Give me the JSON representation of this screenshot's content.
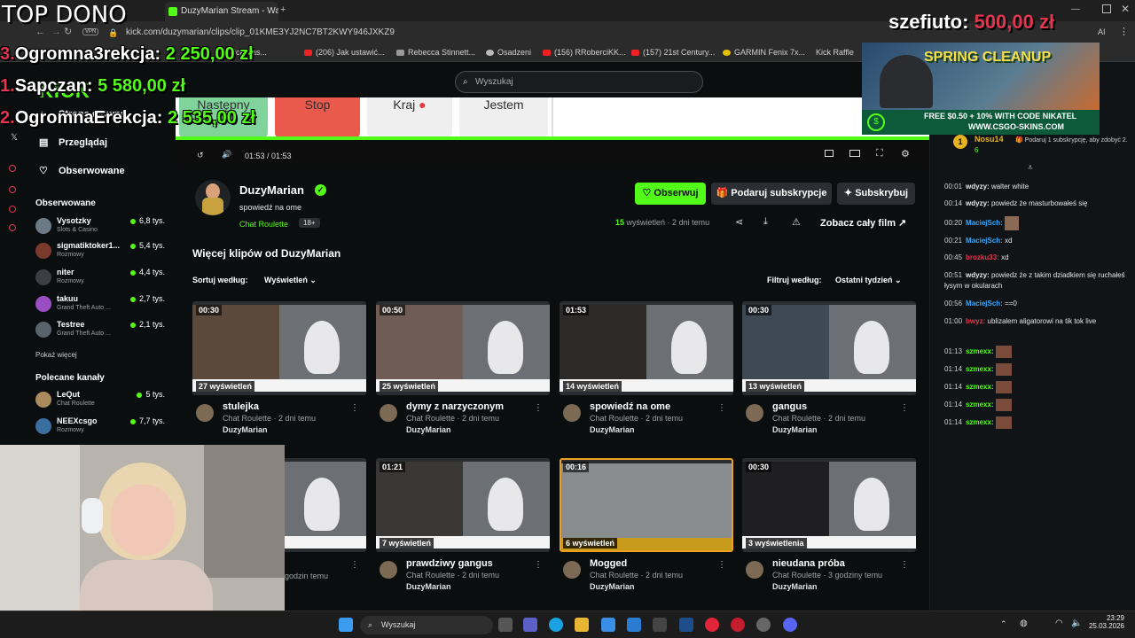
{
  "browser": {
    "tab_title": "DuzyMarian Stream - Watc",
    "url": "kick.com/duzymarian/clips/clip_01KME3YJ2NC7BT2KWY946JXKZ9",
    "vpn_badge": "VPN",
    "bookmarks": [
      "ick Das...",
      "(206) Jak ustawić...",
      "Rebecca Stinnett...",
      "Osadzeni",
      "(156) RRoberciKK...",
      "(157) 21st Century...",
      "GARMIN Fenix 7x...",
      "Kick Raffle"
    ]
  },
  "overlay": {
    "top_label": "TOP DONO",
    "donors": [
      {
        "rank": "3.",
        "name": "Ogromna3rekcja:",
        "amount": "2 250,00 zł"
      },
      {
        "rank": "1.",
        "name": "Sapczan:",
        "amount": "5 580,00 zł"
      },
      {
        "rank": "2.",
        "name": "OgromnaErekcja:",
        "amount": "2 535,00 zł"
      }
    ],
    "top_right": {
      "name": "szefiuto:",
      "amount": "500,00 zł"
    },
    "promo": {
      "title": "SPRING CLEANUP",
      "line1": "FREE $0.50 + 10% WITH CODE NIKATEL",
      "line2": "WWW.CSGO-SKINS.COM"
    }
  },
  "header": {
    "logo": "KICK",
    "search_placeholder": "Wyszukaj"
  },
  "sidebar": {
    "nav": [
      {
        "label": "Strona główna",
        "icon": "home-icon"
      },
      {
        "label": "Przeglądaj",
        "icon": "browse-icon"
      },
      {
        "label": "Obserwowane",
        "icon": "heart-icon"
      }
    ],
    "followed_title": "Obserwowane",
    "followed": [
      {
        "name": "Vysotzky",
        "category": "Slots & Casino",
        "viewers": "6,8 tys."
      },
      {
        "name": "sigmatiktoker1...",
        "category": "Rozmowy",
        "viewers": "5,4 tys."
      },
      {
        "name": "niter",
        "category": "Rozmowy",
        "viewers": "4,4 tys."
      },
      {
        "name": "takuu",
        "category": "Grand Theft Auto ...",
        "viewers": "2,7 tys."
      },
      {
        "name": "Testree",
        "category": "Grand Theft Auto ...",
        "viewers": "2,1 tys."
      }
    ],
    "show_more": "Pokaż więcej",
    "recommended_title": "Polecane kanały",
    "recommended": [
      {
        "name": "LeQut",
        "category": "Chat Roulette",
        "viewers": "5 tys."
      },
      {
        "name": "NEEXcsgo",
        "category": "Rozmowy",
        "viewers": "7,7 tys."
      }
    ]
  },
  "player": {
    "choices": [
      "Następny",
      "Stop",
      "Kraj",
      "Jestem"
    ],
    "time": "01:53 / 01:53",
    "progress_fraction": 1.0
  },
  "channel": {
    "name": "DuzyMarian",
    "clip_title": "spowiedź na ome",
    "category": "Chat Roulette",
    "age_badge": "18+",
    "follow_label": "Obserwuj",
    "gift_label": "Podaruj subskrypcje",
    "subscribe_label": "Subskrybuj",
    "views_count": "15",
    "views_label": "wyświetleń",
    "time_ago": "2 dni temu",
    "watch_full": "Zobacz cały film"
  },
  "clips": {
    "heading": "Więcej klipów od DuzyMarian",
    "sort_label": "Sortuj według:",
    "sort_value": "Wyświetleń",
    "filter_label": "Filtruj według:",
    "filter_value": "Ostatni tydzień",
    "items": [
      {
        "duration": "00:30",
        "views": "27 wyświetleń",
        "title": "stulejka",
        "meta": "Chat Roulette · 2 dni temu",
        "author": "DuzyMarian"
      },
      {
        "duration": "00:50",
        "views": "25 wyświetleń",
        "title": "dymy z narzyczonym",
        "meta": "Chat Roulette · 2 dni temu",
        "author": "DuzyMarian"
      },
      {
        "duration": "01:53",
        "views": "14 wyświetleń",
        "title": "spowiedź na ome",
        "meta": "Chat Roulette · 2 dni temu",
        "author": "DuzyMarian"
      },
      {
        "duration": "00:30",
        "views": "13 wyświetleń",
        "title": "gangus",
        "meta": "Chat Roulette · 2 dni temu",
        "author": "DuzyMarian"
      },
      {
        "duration": "",
        "views": "",
        "title": "",
        "meta": "godzin temu",
        "author": ""
      },
      {
        "duration": "01:21",
        "views": "7 wyświetleń",
        "title": "prawdziwy gangus",
        "meta": "Chat Roulette · 2 dni temu",
        "author": "DuzyMarian"
      },
      {
        "duration": "00:16",
        "views": "6 wyświetleń",
        "title": "Mogged",
        "meta": "Chat Roulette · 2 dni temu",
        "author": "DuzyMarian"
      },
      {
        "duration": "00:30",
        "views": "3 wyświetlenia",
        "title": "nieudana próba",
        "meta": "Chat Roulette · 3 godziny temu",
        "author": "DuzyMarian"
      }
    ]
  },
  "chat": {
    "gifter_name": "Nosu14",
    "gifter_count": "6",
    "gift_text": "Podaruj 1 subskrypcję, aby zdobyć 2.",
    "messages": [
      {
        "time": "00:01",
        "user": "wdyzy:",
        "text": "walter white",
        "color": "#e7e9ea"
      },
      {
        "time": "00:14",
        "user": "wdyzy:",
        "text": "powiedz że masturbowałeś się",
        "color": "#e7e9ea"
      },
      {
        "time": "00:20",
        "user": "MaciejSch:",
        "text": "",
        "color": "#33a8ff"
      },
      {
        "time": "00:21",
        "user": "MaciejSch:",
        "text": "xd",
        "color": "#33a8ff"
      },
      {
        "time": "00:45",
        "user": "brozku33:",
        "text": "xd",
        "color": "#e0364f"
      },
      {
        "time": "00:51",
        "user": "wdyzy:",
        "text": "powiedz że z takim dziadkiem się ruchałeś łysym w okularach",
        "color": "#e7e9ea"
      },
      {
        "time": "00:56",
        "user": "MaciejSch:",
        "text": "==0",
        "color": "#33a8ff"
      },
      {
        "time": "01:00",
        "user": "bwyz:",
        "text": "ublizalem aligatorowi na tik tok live",
        "color": "#e0364f"
      },
      {
        "time": "01:13",
        "user": "szmexx:",
        "text": "",
        "color": "#53fc18"
      },
      {
        "time": "01:14",
        "user": "szmexx:",
        "text": "",
        "color": "#53fc18"
      },
      {
        "time": "01:14",
        "user": "szmexx:",
        "text": "",
        "color": "#53fc18"
      },
      {
        "time": "01:14",
        "user": "szmexx:",
        "text": "",
        "color": "#53fc18"
      },
      {
        "time": "01:14",
        "user": "szmexx:",
        "text": "",
        "color": "#53fc18"
      }
    ]
  },
  "taskbar": {
    "search_label": "Wyszukaj",
    "time": "23:29",
    "date": "25.03.2026"
  },
  "colors": {
    "accent": "#53fc18",
    "bg": "#0b0e0f",
    "chat_bg": "#111416"
  }
}
